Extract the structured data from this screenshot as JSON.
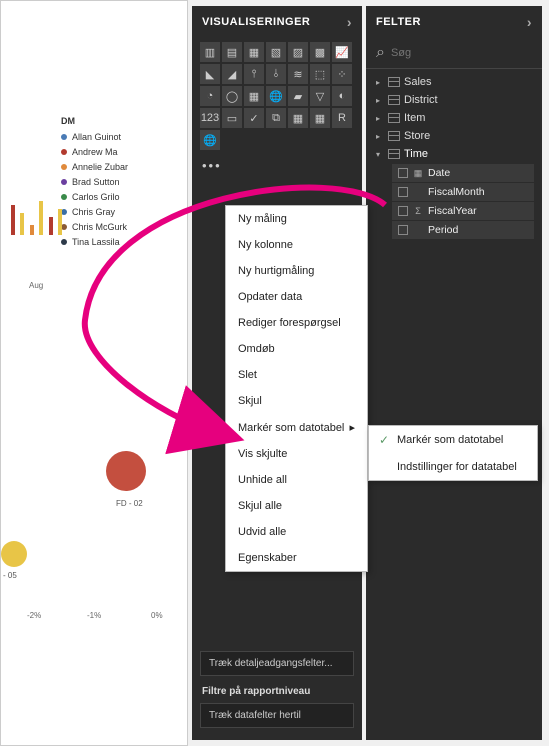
{
  "panels": {
    "viz_title": "VISUALISERINGER",
    "fields_title": "FELTER"
  },
  "search": {
    "placeholder": "Søg"
  },
  "legend": {
    "title": "DM",
    "items": [
      {
        "label": "Allan Guinot",
        "color": "#4a7bb5"
      },
      {
        "label": "Andrew Ma",
        "color": "#b23a2e"
      },
      {
        "label": "Annelie Zubar",
        "color": "#e08a3c"
      },
      {
        "label": "Brad Sutton",
        "color": "#6b3fa0"
      },
      {
        "label": "Carlos Grilo",
        "color": "#3a8a4a"
      },
      {
        "label": "Chris Gray",
        "color": "#3a6ea5"
      },
      {
        "label": "Chris McGurk",
        "color": "#8a5a36"
      },
      {
        "label": "Tina Lassila",
        "color": "#2d3a4a"
      }
    ]
  },
  "chart": {
    "xlabel": "Aug"
  },
  "bubbles": {
    "fd_label": "FD - 02",
    "other_label": "- 05"
  },
  "axis": {
    "ticks": [
      "-2%",
      "-1%",
      "0%"
    ]
  },
  "viz_well": {
    "drill_label": "Træk detaljeadgangsfelter...",
    "report_filters": "Filtre på rapportniveau",
    "drag_fields": "Træk datafelter hertil"
  },
  "tables": [
    {
      "name": "Sales"
    },
    {
      "name": "District"
    },
    {
      "name": "Item"
    },
    {
      "name": "Store"
    },
    {
      "name": "Time",
      "expanded": true,
      "fields": [
        {
          "name": "Date",
          "type": "date"
        },
        {
          "name": "FiscalMonth",
          "type": "text"
        },
        {
          "name": "FiscalYear",
          "type": "sigma"
        },
        {
          "name": "Period",
          "type": "text"
        }
      ]
    }
  ],
  "context_menu": [
    "Ny måling",
    "Ny kolonne",
    "Ny hurtigmåling",
    "Opdater data",
    "Rediger forespørgsel",
    "Omdøb",
    "Slet",
    "Skjul",
    "Markér som datotabel",
    "Vis skjulte",
    "Unhide all",
    "Skjul alle",
    "Udvid alle",
    "Egenskaber"
  ],
  "submenu": {
    "mark": "Markér som datotabel",
    "settings": "Indstillinger for datatabel"
  }
}
